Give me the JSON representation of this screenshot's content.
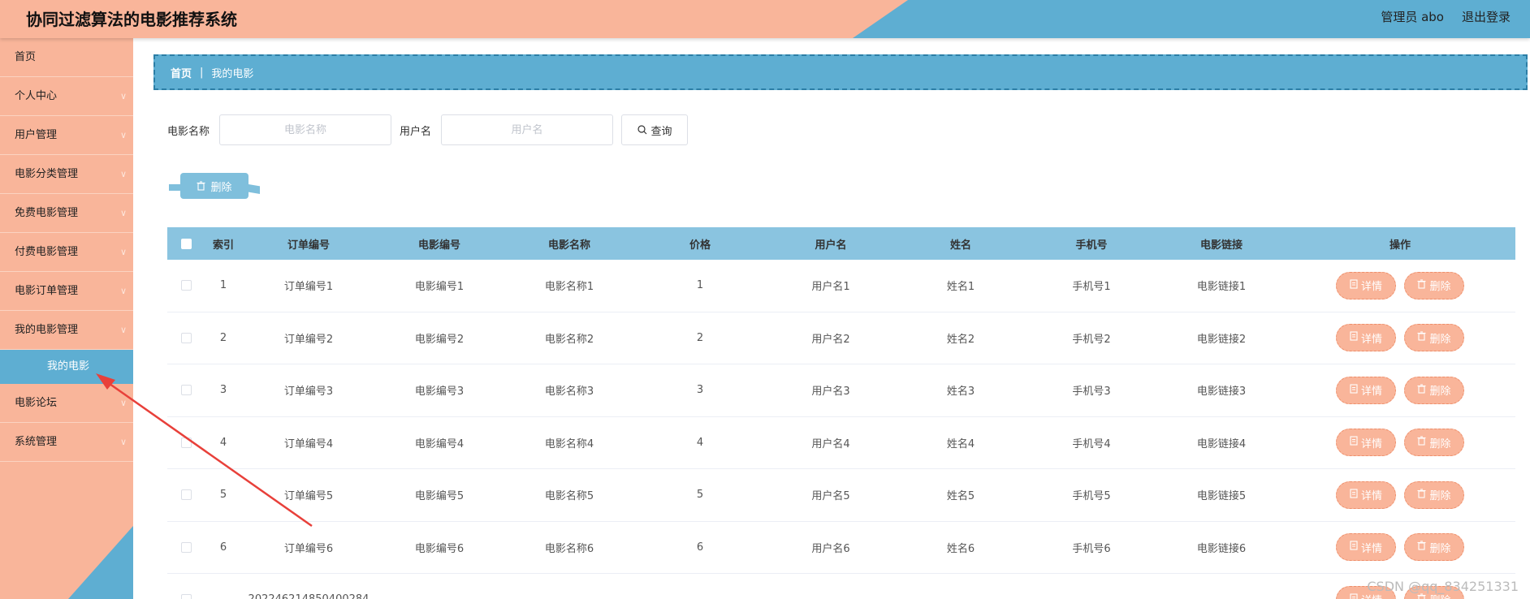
{
  "header": {
    "title": "协同过滤算法的电影推荐系统",
    "user": "管理员 abo",
    "logout": "退出登录"
  },
  "sidebar": {
    "items": [
      {
        "label": "首页",
        "chevron": false
      },
      {
        "label": "个人中心",
        "chevron": true
      },
      {
        "label": "用户管理",
        "chevron": true
      },
      {
        "label": "电影分类管理",
        "chevron": true
      },
      {
        "label": "免费电影管理",
        "chevron": true
      },
      {
        "label": "付费电影管理",
        "chevron": true
      },
      {
        "label": "电影订单管理",
        "chevron": true
      },
      {
        "label": "我的电影管理",
        "chevron": true
      }
    ],
    "active_sub": "我的电影",
    "items_after": [
      {
        "label": "电影论坛",
        "chevron": true
      },
      {
        "label": "系统管理",
        "chevron": true
      }
    ]
  },
  "breadcrumb": {
    "home": "首页",
    "sep": "|",
    "current": "我的电影"
  },
  "search": {
    "movie_label": "电影名称",
    "movie_placeholder": "电影名称",
    "user_label": "用户名",
    "user_placeholder": "用户名",
    "query_label": "查询"
  },
  "bulk_delete_label": "删除",
  "table": {
    "columns": [
      "索引",
      "订单编号",
      "电影编号",
      "电影名称",
      "价格",
      "用户名",
      "姓名",
      "手机号",
      "电影链接",
      "操作"
    ],
    "rows": [
      [
        "1",
        "订单编号1",
        "电影编号1",
        "电影名称1",
        "1",
        "用户名1",
        "姓名1",
        "手机号1",
        "电影链接1"
      ],
      [
        "2",
        "订单编号2",
        "电影编号2",
        "电影名称2",
        "2",
        "用户名2",
        "姓名2",
        "手机号2",
        "电影链接2"
      ],
      [
        "3",
        "订单编号3",
        "电影编号3",
        "电影名称3",
        "3",
        "用户名3",
        "姓名3",
        "手机号3",
        "电影链接3"
      ],
      [
        "4",
        "订单编号4",
        "电影编号4",
        "电影名称4",
        "4",
        "用户名4",
        "姓名4",
        "手机号4",
        "电影链接4"
      ],
      [
        "5",
        "订单编号5",
        "电影编号5",
        "电影名称5",
        "5",
        "用户名5",
        "姓名5",
        "手机号5",
        "电影链接5"
      ],
      [
        "6",
        "订单编号6",
        "电影编号6",
        "电影名称6",
        "6",
        "用户名6",
        "姓名6",
        "手机号6",
        "电影链接6"
      ],
      [
        "",
        "202246214850400284",
        "",
        "",
        "",
        "",
        "",
        "",
        ""
      ]
    ],
    "detail_label": "详情",
    "delete_label": "删除"
  },
  "watermark": "CSDN @qq_834251331",
  "colors": {
    "peach": "#f9b59a",
    "blue": "#5eaed2",
    "table_head": "#8ac4e0"
  }
}
